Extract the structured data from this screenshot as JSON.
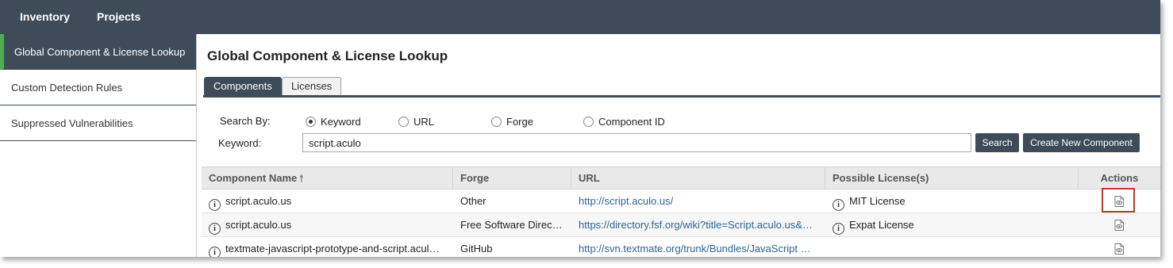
{
  "topnav": {
    "items": [
      "Inventory",
      "Projects"
    ]
  },
  "sidebar": {
    "items": [
      "Global Component & License Lookup",
      "Custom Detection Rules",
      "Suppressed Vulnerabilities"
    ]
  },
  "main": {
    "title": "Global Component & License Lookup",
    "tabs": [
      "Components",
      "Licenses"
    ],
    "search": {
      "search_by_label": "Search By:",
      "options": [
        "Keyword",
        "URL",
        "Forge",
        "Component ID"
      ],
      "selected": "Keyword",
      "keyword_label": "Keyword:",
      "keyword_value": "script.aculo",
      "search_button": "Search",
      "create_button": "Create New Component"
    },
    "table": {
      "headers": [
        "Component Name",
        "Forge",
        "URL",
        "Possible License(s)",
        "Actions"
      ],
      "rows": [
        {
          "name": "script.aculo.us",
          "forge": "Other",
          "url": "http://script.aculo.us/",
          "license": "MIT License"
        },
        {
          "name": "script.aculo.us",
          "forge": "Free Software Direc…",
          "url": "https://directory.fsf.org/wiki?title=Script.aculo.us&…",
          "license": "Expat License"
        },
        {
          "name": "textmate-javascript-prototype-and-script.acul…",
          "forge": "GitHub",
          "url": "http://svn.textmate.org/trunk/Bundles/JavaScript …",
          "license": ""
        }
      ]
    }
  },
  "colors": {
    "nav_bg": "#3e4c59",
    "active_accent": "#4caf50",
    "link": "#2a6496",
    "highlight": "#c0392b"
  },
  "icons": {
    "info": "info-circle-icon",
    "action": "view-document-icon",
    "sort": "sort-up-arrow-icon"
  }
}
